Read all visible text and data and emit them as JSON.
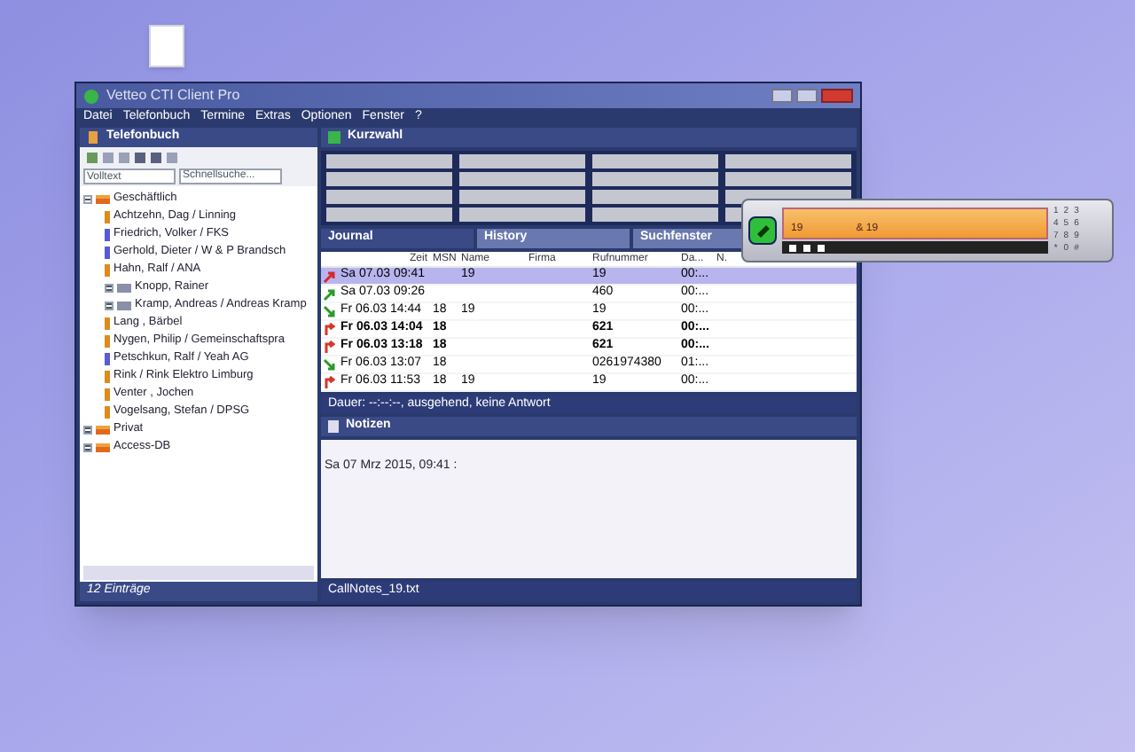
{
  "window": {
    "title": "Vetteo CTI Client Pro"
  },
  "menu": [
    "Datei",
    "Telefonbuch",
    "Termine",
    "Extras",
    "Optionen",
    "Fenster",
    "?"
  ],
  "phonebook": {
    "title": "Telefonbuch",
    "filter": "Volltext",
    "search": {
      "placeholder": "Schnellsuche..."
    },
    "tree": [
      {
        "label": "Geschäftlich",
        "kind": "folder",
        "expanded": true,
        "children": [
          {
            "label": "Achtzehn, Dag  /  Linning",
            "kind": "contact",
            "color": "#e08a1e"
          },
          {
            "label": "Friedrich, Volker  /  FKS",
            "kind": "contact",
            "color": "#5a5ad8"
          },
          {
            "label": "Gerhold, Dieter  /  W & P Brandsch",
            "kind": "contact",
            "color": "#5a5ad8"
          },
          {
            "label": "Hahn, Ralf  /  ANA",
            "kind": "contact",
            "color": "#e08a1e"
          },
          {
            "label": "Knopp, Rainer",
            "kind": "group",
            "expanded": false
          },
          {
            "label": "Kramp, Andreas  /  Andreas Kramp",
            "kind": "group",
            "expanded": false
          },
          {
            "label": "Lang , Bärbel",
            "kind": "contact",
            "color": "#e08a1e"
          },
          {
            "label": "Nygen, Philip  /  Gemeinschaftspra",
            "kind": "contact",
            "color": "#e08a1e"
          },
          {
            "label": "Petschkun, Ralf  /  Yeah AG",
            "kind": "contact",
            "color": "#5a5ad8"
          },
          {
            "label": "Rink  /  Rink Elektro Limburg",
            "kind": "contact",
            "color": "#e08a1e"
          },
          {
            "label": "Venter , Jochen",
            "kind": "contact",
            "color": "#e08a1e"
          },
          {
            "label": "Vogelsang, Stefan  /  DPSG",
            "kind": "contact",
            "color": "#e08a1e"
          }
        ]
      },
      {
        "label": "Privat",
        "kind": "folder",
        "expanded": false
      },
      {
        "label": "Access-DB",
        "kind": "folder",
        "expanded": false
      }
    ],
    "count": "12 Einträge"
  },
  "speed_dial": {
    "title": "Kurzwahl"
  },
  "tabs": [
    {
      "label": "Journal",
      "selected": true
    },
    {
      "label": "History",
      "selected": false
    },
    {
      "label": "Suchfenster",
      "selected": false
    }
  ],
  "journal": {
    "columns": [
      "Zeit",
      "MSN",
      "Name",
      "Firma",
      "Rufnummer",
      "Da...",
      "N."
    ],
    "rows": [
      {
        "kind": "outgoing_unanswered",
        "time": "Sa 07.03 09:41",
        "msn": "",
        "name": "19",
        "number": "19",
        "duration": "00:...",
        "selected": true,
        "unread": false
      },
      {
        "kind": "outgoing",
        "time": "Sa 07.03 09:26",
        "msn": "",
        "name": "",
        "number": "460",
        "duration": "00:...",
        "selected": false,
        "unread": false
      },
      {
        "kind": "incoming",
        "time": "Fr 06.03 14:44",
        "msn": "18",
        "name": "19",
        "number": "19",
        "duration": "00:...",
        "selected": false,
        "unread": false
      },
      {
        "kind": "missed",
        "time": "Fr 06.03 14:04",
        "msn": "18",
        "name": "",
        "number": "621",
        "duration": "00:...",
        "selected": false,
        "unread": true
      },
      {
        "kind": "missed",
        "time": "Fr 06.03 13:18",
        "msn": "18",
        "name": "",
        "number": "621",
        "duration": "00:...",
        "selected": false,
        "unread": true
      },
      {
        "kind": "incoming",
        "time": "Fr 06.03 13:07",
        "msn": "18",
        "name": "",
        "number": "0261974380",
        "duration": "01:...",
        "selected": false,
        "unread": false
      },
      {
        "kind": "missed",
        "time": "Fr 06.03 11:53",
        "msn": "18",
        "name": "19",
        "number": "19",
        "duration": "00:...",
        "selected": false,
        "unread": false
      }
    ],
    "status": "Dauer: --:--:--, ausgehend, keine Antwort"
  },
  "notes": {
    "title": "Notizen",
    "text": "Sa 07 Mrz 2015, 09:41 :",
    "file": "CallNotes_19.txt"
  },
  "phone_widget": {
    "line": "19",
    "target": "& 19",
    "keys": [
      "1",
      "2",
      "3",
      "4",
      "5",
      "6",
      "7",
      "8",
      "9",
      "*",
      "0",
      "#"
    ]
  }
}
